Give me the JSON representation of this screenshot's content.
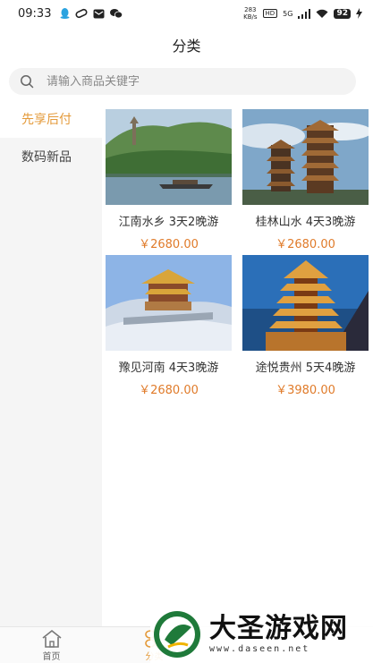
{
  "status_bar": {
    "time": "09:33",
    "net_speed_value": "283",
    "net_speed_unit": "KB/s",
    "hd_label": "HD",
    "network_label": "5G",
    "battery": "92"
  },
  "header": {
    "title": "分类"
  },
  "search": {
    "placeholder": "请输入商品关键字"
  },
  "sidebar": {
    "items": [
      {
        "label": "先享后付",
        "active": true
      },
      {
        "label": "数码新品",
        "active": false
      }
    ]
  },
  "products": [
    {
      "name": "江南水乡 3天2晚游",
      "price": "￥2680.00"
    },
    {
      "name": "桂林山水 4天3晚游",
      "price": "￥2680.00"
    },
    {
      "name": "豫见河南 4天3晚游",
      "price": "￥2680.00"
    },
    {
      "name": "途悦贵州 5天4晚游",
      "price": "￥3980.00"
    }
  ],
  "tab_bar": {
    "tabs": [
      {
        "label": "首页",
        "icon": "home-icon",
        "active": false
      },
      {
        "label": "分类",
        "icon": "category-icon",
        "active": true
      }
    ]
  },
  "watermark": {
    "title": "大圣游戏网",
    "url": "www.daseen.net"
  },
  "colors": {
    "accent": "#e49a3a",
    "price": "#e07b2a",
    "sidebar_bg": "#f5f5f5"
  }
}
